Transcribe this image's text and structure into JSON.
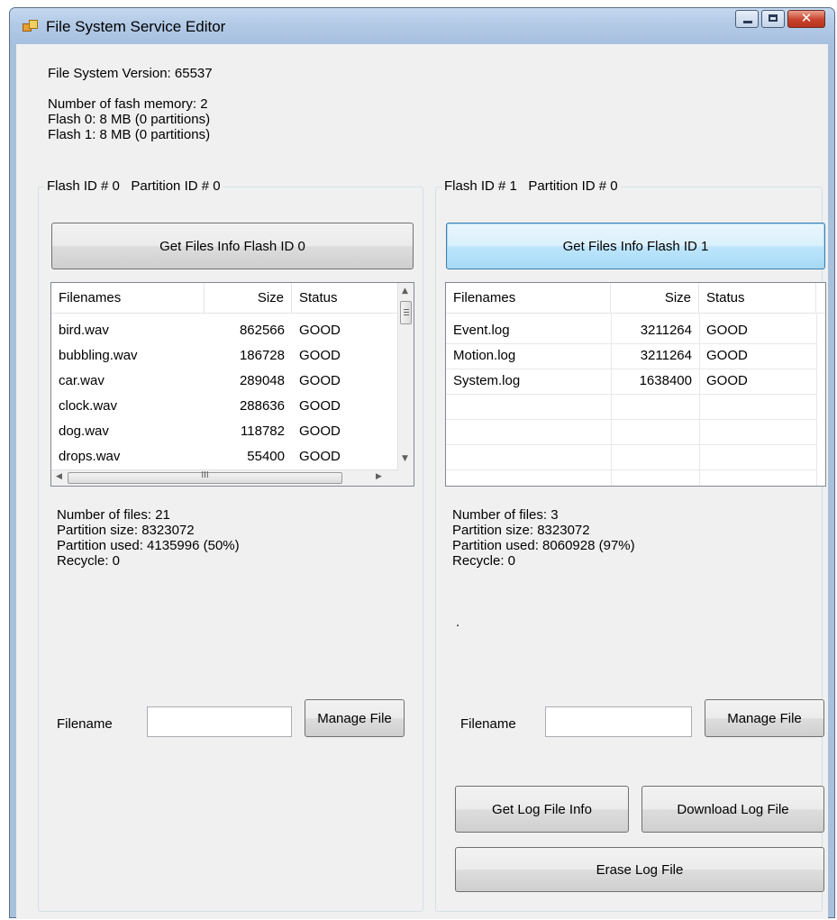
{
  "window": {
    "title": "File System Service Editor",
    "close_glyph": "✕"
  },
  "info": {
    "version": "File System Version: 65537",
    "flash_count": "Number of fash memory: 2",
    "flash0": "Flash 0: 8 MB (0 partitions)",
    "flash1": "Flash 1: 8 MB (0 partitions)"
  },
  "left": {
    "group_title": "Flash ID # 0   Partition ID # 0",
    "get_button": "Get Files Info Flash ID 0",
    "columns": [
      "Filenames",
      "Size",
      "Status"
    ],
    "rows": [
      {
        "name": "bird.wav",
        "size": "862566",
        "status": "GOOD"
      },
      {
        "name": "bubbling.wav",
        "size": "186728",
        "status": "GOOD"
      },
      {
        "name": "car.wav",
        "size": "289048",
        "status": "GOOD"
      },
      {
        "name": "clock.wav",
        "size": "288636",
        "status": "GOOD"
      },
      {
        "name": "dog.wav",
        "size": "118782",
        "status": "GOOD"
      },
      {
        "name": "drops.wav",
        "size": "55400",
        "status": "GOOD"
      }
    ],
    "scroll_h_glyph": "III",
    "stats": {
      "files": "Number of files: 21",
      "partition_size": "Partition size: 8323072",
      "partition_used": "Partition used: 4135996 (50%)",
      "recycle": "Recycle: 0"
    },
    "filename_label": "Filename",
    "filename_value": "",
    "manage_button": "Manage File"
  },
  "right": {
    "group_title": "Flash ID # 1   Partition ID # 0",
    "get_button": "Get Files Info Flash ID 1",
    "columns": [
      "Filenames",
      "Size",
      "Status"
    ],
    "rows": [
      {
        "name": "Event.log",
        "size": "3211264",
        "status": "GOOD"
      },
      {
        "name": "Motion.log",
        "size": "3211264",
        "status": "GOOD"
      },
      {
        "name": "System.log",
        "size": "1638400",
        "status": "GOOD"
      }
    ],
    "stats": {
      "files": "Number of files: 3",
      "partition_size": "Partition size: 8323072",
      "partition_used": "Partition used: 8060928 (97%)",
      "recycle": "Recycle: 0"
    },
    "dot": ".",
    "filename_label": "Filename",
    "filename_value": "",
    "manage_button": "Manage File",
    "get_log_button": "Get Log File Info",
    "download_log_button": "Download Log File",
    "erase_log_button": "Erase Log File"
  }
}
